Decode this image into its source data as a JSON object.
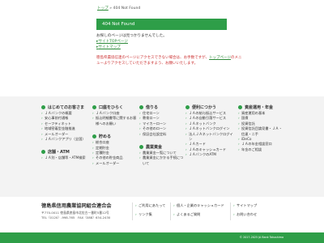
{
  "breadcrumb": {
    "home": "トップ",
    "sep": "»",
    "current": "404 Not Found"
  },
  "main": {
    "title": "404 Not Found",
    "message": "お探しのページは見つかりませんでした。",
    "links": [
      "サイトTOPページ",
      "サイトマップ"
    ],
    "desc_before": "徳島県農協信連のページにアクセスできない場合は、お手数ですが、",
    "desc_link": "トップページ",
    "desc_after": "のメニューよりアクセスしていただきますよう、お願いいたします。"
  },
  "footer_nav": {
    "col1": {
      "title": "はじめてのお客さま",
      "items": [
        "ＪＡバンクの概要",
        "安心事前付通帳",
        "セーフティネット",
        "地域密着型金融推進",
        "メールオーダー",
        "ＪＡバンクアプリ（全国）"
      ],
      "title2": "店舗・ATM",
      "items2": [
        "ＪＡ別・店舗等・ATM検索"
      ]
    },
    "col2": {
      "title": "口座をひらく",
      "items": [
        "ＪＡバンク口座",
        "振込明細書等に関するお客様へのお願い"
      ],
      "title2": "貯める",
      "items2": [
        "総合口座",
        "定期貯金",
        "定積貯金",
        "その他の貯金商品",
        "メールオーダー"
      ]
    },
    "col3": {
      "title": "借りる",
      "items": [
        "住宅ローン",
        "教育ローン",
        "マイカーローン",
        "その他のローン",
        "保証会社設定料"
      ],
      "title2": "農業資金",
      "items2": [
        "農業資金一覧について",
        "農業資金にかかる手続について"
      ]
    },
    "col4": {
      "title": "便利につかう",
      "items": [
        "ＪＡの給与振込サービス",
        "ＪＡの自動引落サービス",
        "ＪＡネットバンク",
        "ＪＡネットバンクログイン",
        "法人ＪＡネットバンクログイン",
        "ＪＡカード",
        "ＪＡのキャッシュカード",
        "ＪＡバンクのATM"
      ]
    },
    "col5": {
      "title": "資産運用・年金",
      "items": [
        "資産運用の基本",
        "国債",
        "投資信託",
        "投資信託目論見書・ＪＡ・信連・ニ手",
        "iDeCo",
        "ＪＡの年金相談窓口",
        "年金のご相談"
      ]
    }
  },
  "bottom": {
    "bank_name": "徳島県信用農業協同組合連合会",
    "address": "〒770-0011 徳島県徳島市北佐古一番町5番12号",
    "phone": "TEL（0120）-998-765　FAX（088）634-2430",
    "links": [
      "ご利用にあたって",
      "リンク集",
      "個人・企業のキャッシュカード",
      "よくあるご質問",
      "サイトマップ",
      "お問い合わせ"
    ]
  },
  "copyright": "© 2017-2025 JA Bank Tokushima"
}
